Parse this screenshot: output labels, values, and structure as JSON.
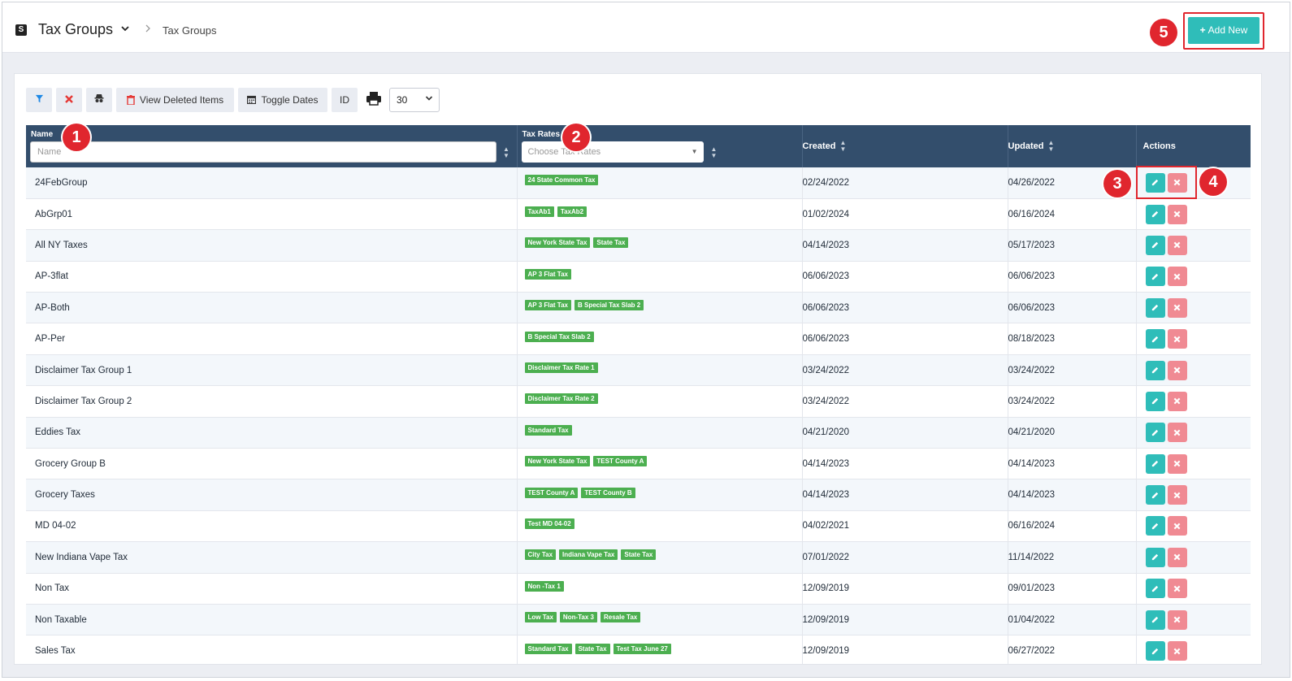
{
  "header": {
    "app_icon": "S",
    "title": "Tax Groups",
    "breadcrumb": "Tax Groups",
    "add_new_label": "Add New"
  },
  "toolbar": {
    "view_deleted_label": "View Deleted Items",
    "toggle_dates_label": "Toggle Dates",
    "id_label": "ID",
    "page_size": "30",
    "icons": [
      "filter-icon",
      "clear-filter-icon",
      "incognito-icon",
      "trash-icon",
      "calendar-icon",
      "print-icon"
    ]
  },
  "table": {
    "columns": {
      "name": "Name",
      "tax_rates": "Tax Rates",
      "created": "Created",
      "updated": "Updated",
      "actions": "Actions"
    },
    "name_placeholder": "Name",
    "tax_rates_placeholder": "Choose Tax Rates",
    "rows": [
      {
        "name": "24FebGroup",
        "rates": [
          "24 State Common Tax"
        ],
        "created": "02/24/2022",
        "updated": "04/26/2022"
      },
      {
        "name": "AbGrp01",
        "rates": [
          "TaxAb1",
          "TaxAb2"
        ],
        "created": "01/02/2024",
        "updated": "06/16/2024"
      },
      {
        "name": "All NY Taxes",
        "rates": [
          "New York State Tax",
          "State Tax"
        ],
        "created": "04/14/2023",
        "updated": "05/17/2023"
      },
      {
        "name": "AP-3flat",
        "rates": [
          "AP 3 Flat Tax"
        ],
        "created": "06/06/2023",
        "updated": "06/06/2023"
      },
      {
        "name": "AP-Both",
        "rates": [
          "AP 3 Flat Tax",
          "B Special Tax Slab 2"
        ],
        "created": "06/06/2023",
        "updated": "06/06/2023"
      },
      {
        "name": "AP-Per",
        "rates": [
          "B Special Tax Slab 2"
        ],
        "created": "06/06/2023",
        "updated": "08/18/2023"
      },
      {
        "name": "Disclaimer Tax Group 1",
        "rates": [
          "Disclaimer Tax Rate 1"
        ],
        "created": "03/24/2022",
        "updated": "03/24/2022"
      },
      {
        "name": "Disclaimer Tax Group 2",
        "rates": [
          "Disclaimer Tax Rate 2"
        ],
        "created": "03/24/2022",
        "updated": "03/24/2022"
      },
      {
        "name": "Eddies Tax",
        "rates": [
          "Standard Tax"
        ],
        "created": "04/21/2020",
        "updated": "04/21/2020"
      },
      {
        "name": "Grocery Group B",
        "rates": [
          "New York State Tax",
          "TEST County A"
        ],
        "created": "04/14/2023",
        "updated": "04/14/2023"
      },
      {
        "name": "Grocery Taxes",
        "rates": [
          "TEST County A",
          "TEST County B"
        ],
        "created": "04/14/2023",
        "updated": "04/14/2023"
      },
      {
        "name": "MD 04-02",
        "rates": [
          "Test MD 04-02"
        ],
        "created": "04/02/2021",
        "updated": "06/16/2024"
      },
      {
        "name": "New Indiana Vape Tax",
        "rates": [
          "City Tax",
          "Indiana Vape Tax",
          "State Tax"
        ],
        "created": "07/01/2022",
        "updated": "11/14/2022"
      },
      {
        "name": "Non Tax",
        "rates": [
          "Non -Tax 1"
        ],
        "created": "12/09/2019",
        "updated": "09/01/2023"
      },
      {
        "name": "Non Taxable",
        "rates": [
          "Low Tax",
          "Non-Tax 3",
          "Resale Tax"
        ],
        "created": "12/09/2019",
        "updated": "01/04/2022"
      },
      {
        "name": "Sales Tax",
        "rates": [
          "Standard Tax",
          "State Tax",
          "Test Tax June 27"
        ],
        "created": "12/09/2019",
        "updated": "06/27/2022"
      }
    ]
  },
  "markers": [
    "1",
    "2",
    "3",
    "4",
    "5"
  ],
  "colors": {
    "header_bg": "#334e6c",
    "accent_teal": "#2fbdb9",
    "delete_pink": "#f08a93",
    "tag_green": "#4caf50",
    "marker_red": "#e0262e"
  }
}
